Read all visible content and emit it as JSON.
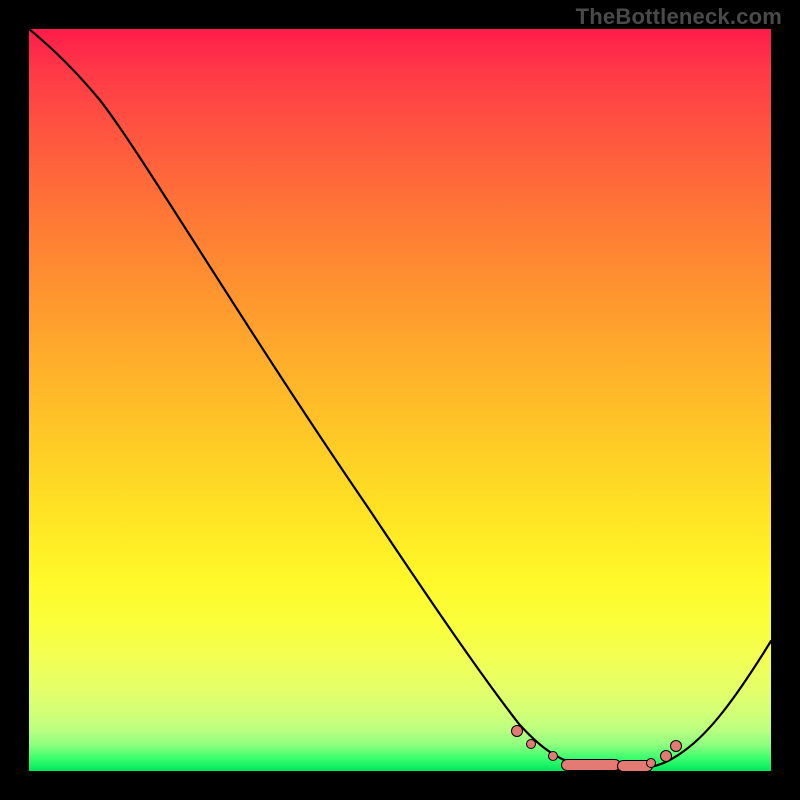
{
  "watermark": "TheBottleneck.com",
  "chart_data": {
    "type": "line",
    "title": "",
    "xlabel": "",
    "ylabel": "",
    "xlim": [
      0,
      100
    ],
    "ylim": [
      0,
      100
    ],
    "grid": false,
    "background": "rainbow-vertical-gradient",
    "series": [
      {
        "name": "bottleneck-curve",
        "x": [
          0,
          4,
          8,
          12,
          16,
          22,
          30,
          40,
          50,
          58,
          63,
          66,
          69,
          72,
          75,
          78,
          81,
          84,
          87,
          90,
          93,
          96,
          100
        ],
        "y": [
          100,
          97,
          94,
          91,
          87.5,
          80,
          68,
          52,
          36.5,
          24,
          16,
          11.5,
          8,
          5,
          3,
          1.8,
          1.2,
          1.2,
          1.8,
          3.2,
          6,
          10.5,
          18
        ]
      }
    ],
    "markers": {
      "name": "highlight-dots",
      "color": "#e37a74",
      "points": [
        {
          "x": 67,
          "y": 6.0
        },
        {
          "x": 69,
          "y": 4.0
        },
        {
          "x": 73,
          "y": 3.0
        },
        {
          "x": 81,
          "y": 1.5
        },
        {
          "x": 84,
          "y": 2.0
        },
        {
          "x": 87,
          "y": 4.0
        }
      ],
      "segments": [
        {
          "x1": 73,
          "x2": 80,
          "y": 2.8
        },
        {
          "x1": 80,
          "x2": 85,
          "y": 2.8
        }
      ]
    }
  }
}
